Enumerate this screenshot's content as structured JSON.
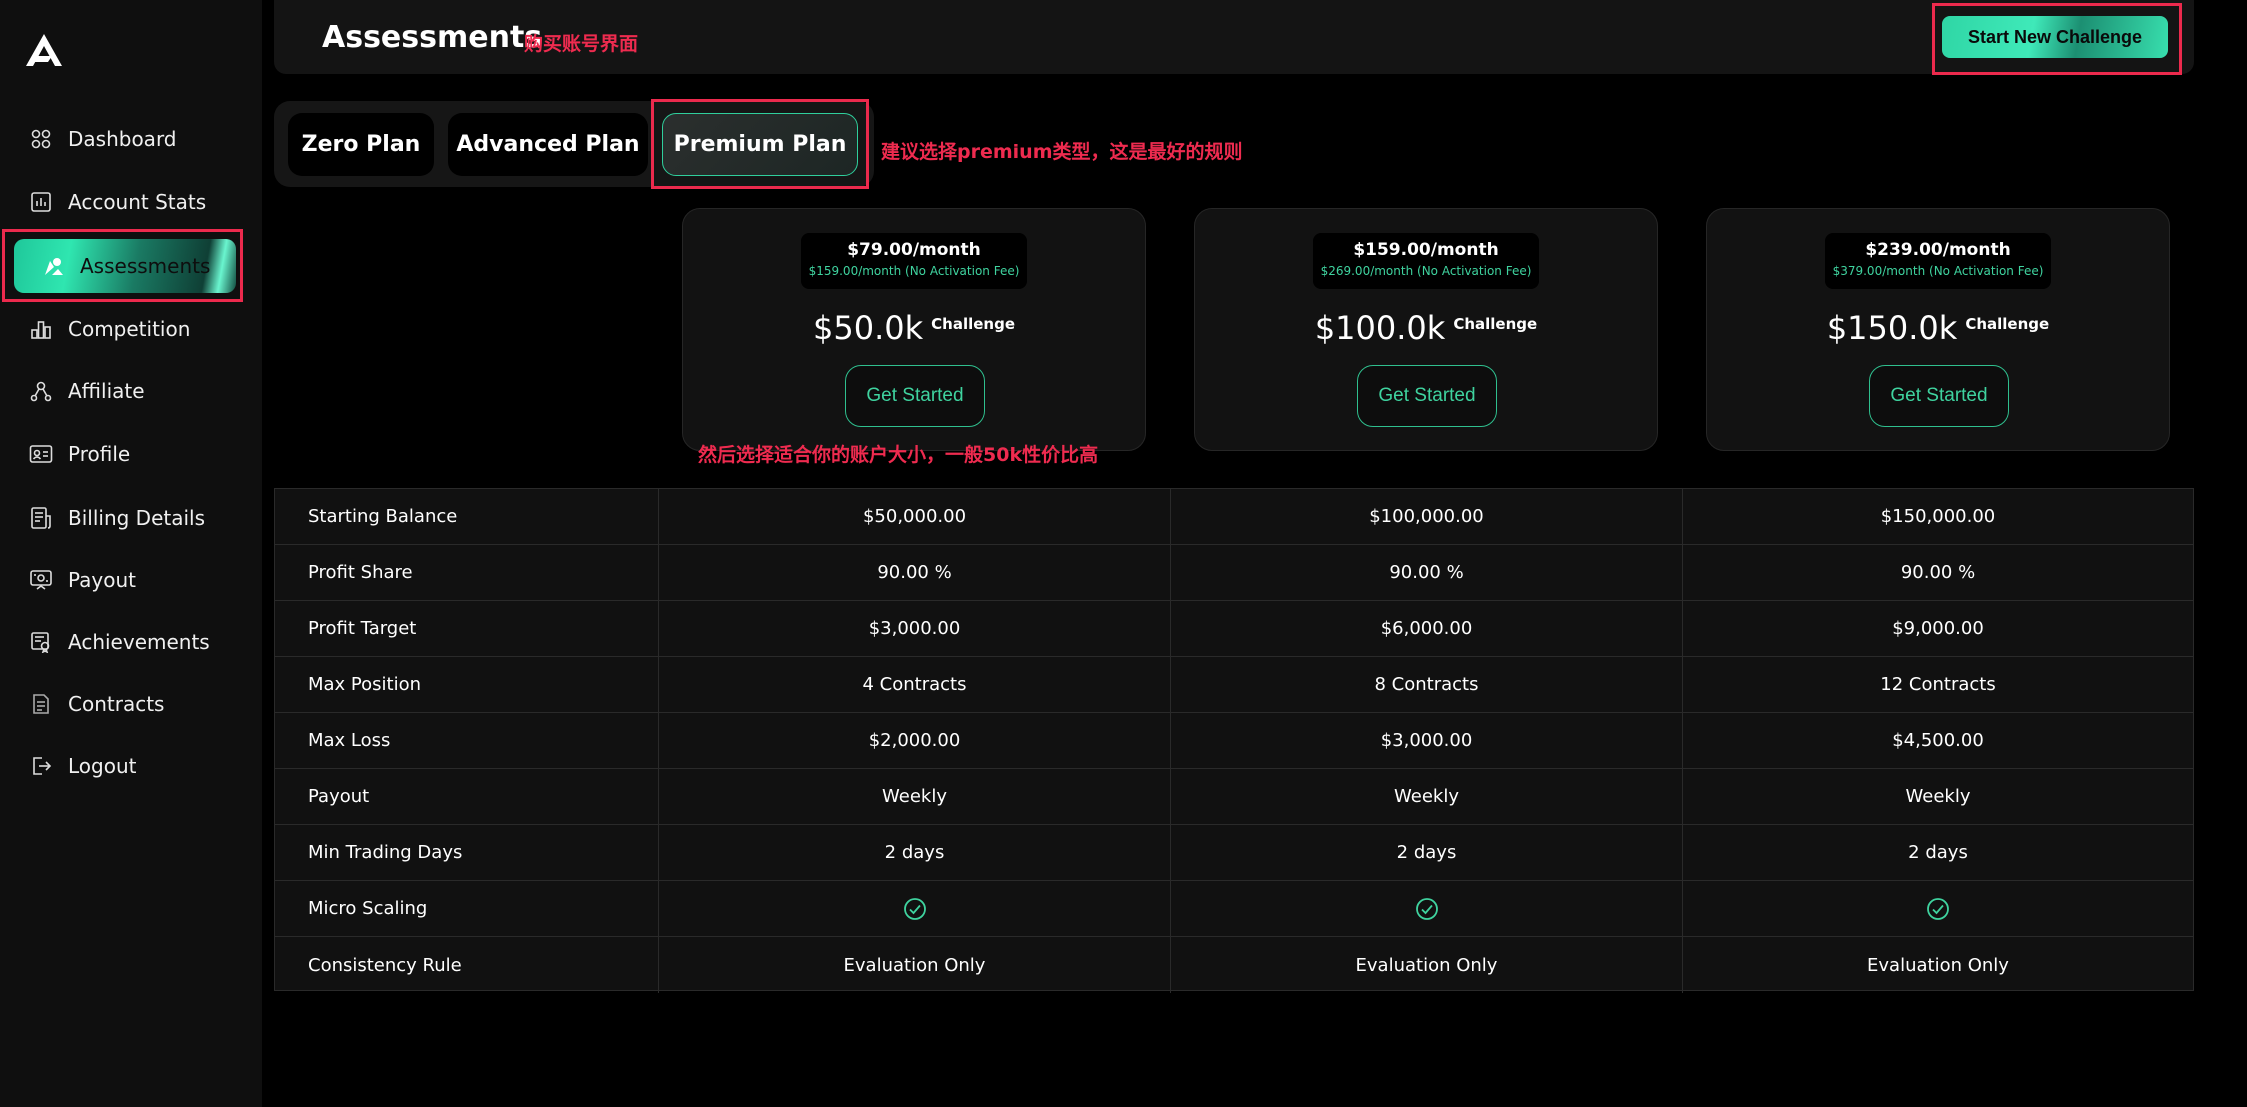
{
  "sidebar": {
    "items": [
      {
        "label": "Dashboard",
        "icon": "grid-icon"
      },
      {
        "label": "Account Stats",
        "icon": "bar-chart-icon"
      },
      {
        "label": "Assessments",
        "icon": "assessment-icon"
      },
      {
        "label": "Competition",
        "icon": "podium-chart-icon"
      },
      {
        "label": "Affiliate",
        "icon": "network-icon"
      },
      {
        "label": "Profile",
        "icon": "id-card-icon"
      },
      {
        "label": "Billing Details",
        "icon": "receipt-icon"
      },
      {
        "label": "Payout",
        "icon": "payout-icon"
      },
      {
        "label": "Achievements",
        "icon": "certificate-icon"
      },
      {
        "label": "Contracts",
        "icon": "document-icon"
      },
      {
        "label": "Logout",
        "icon": "logout-icon"
      }
    ],
    "active": "Assessments"
  },
  "header": {
    "title": "Assessments",
    "note": "购买账号界面",
    "start_button": "Start New Challenge"
  },
  "tabs": {
    "items": [
      "Zero Plan",
      "Advanced Plan",
      "Premium Plan"
    ],
    "active": "Premium Plan",
    "note": "建议选择premium类型，这是最好的规则"
  },
  "cards": [
    {
      "price": "$79.00/month",
      "sub": "$159.00/month (No Activation Fee)",
      "size": "$50.0k",
      "size_label": "Challenge",
      "button": "Get Started"
    },
    {
      "price": "$159.00/month",
      "sub": "$269.00/month (No Activation Fee)",
      "size": "$100.0k",
      "size_label": "Challenge",
      "button": "Get Started"
    },
    {
      "price": "$239.00/month",
      "sub": "$379.00/month (No Activation Fee)",
      "size": "$150.0k",
      "size_label": "Challenge",
      "button": "Get Started"
    }
  ],
  "cards_note": "然后选择适合你的账户大小，一般50k性价比高",
  "table": {
    "rows": [
      {
        "label": "Starting Balance",
        "values": [
          "$50,000.00",
          "$100,000.00",
          "$150,000.00"
        ]
      },
      {
        "label": "Profit Share",
        "values": [
          "90.00 %",
          "90.00 %",
          "90.00 %"
        ]
      },
      {
        "label": "Profit Target",
        "values": [
          "$3,000.00",
          "$6,000.00",
          "$9,000.00"
        ]
      },
      {
        "label": "Max Position",
        "values": [
          "4 Contracts",
          "8 Contracts",
          "12 Contracts"
        ]
      },
      {
        "label": "Max Loss",
        "values": [
          "$2,000.00",
          "$3,000.00",
          "$4,500.00"
        ]
      },
      {
        "label": "Payout",
        "values": [
          "Weekly",
          "Weekly",
          "Weekly"
        ]
      },
      {
        "label": "Min Trading Days",
        "values": [
          "2 days",
          "2 days",
          "2 days"
        ]
      },
      {
        "label": "Micro Scaling",
        "values": [
          "check",
          "check",
          "check"
        ]
      },
      {
        "label": "Consistency Rule",
        "values": [
          "Evaluation Only",
          "Evaluation Only",
          "Evaluation Only"
        ]
      }
    ]
  },
  "colors": {
    "accent": "#2fd6a5",
    "annotation": "#ec2a4d",
    "background": "#000000",
    "panel": "#141414"
  }
}
